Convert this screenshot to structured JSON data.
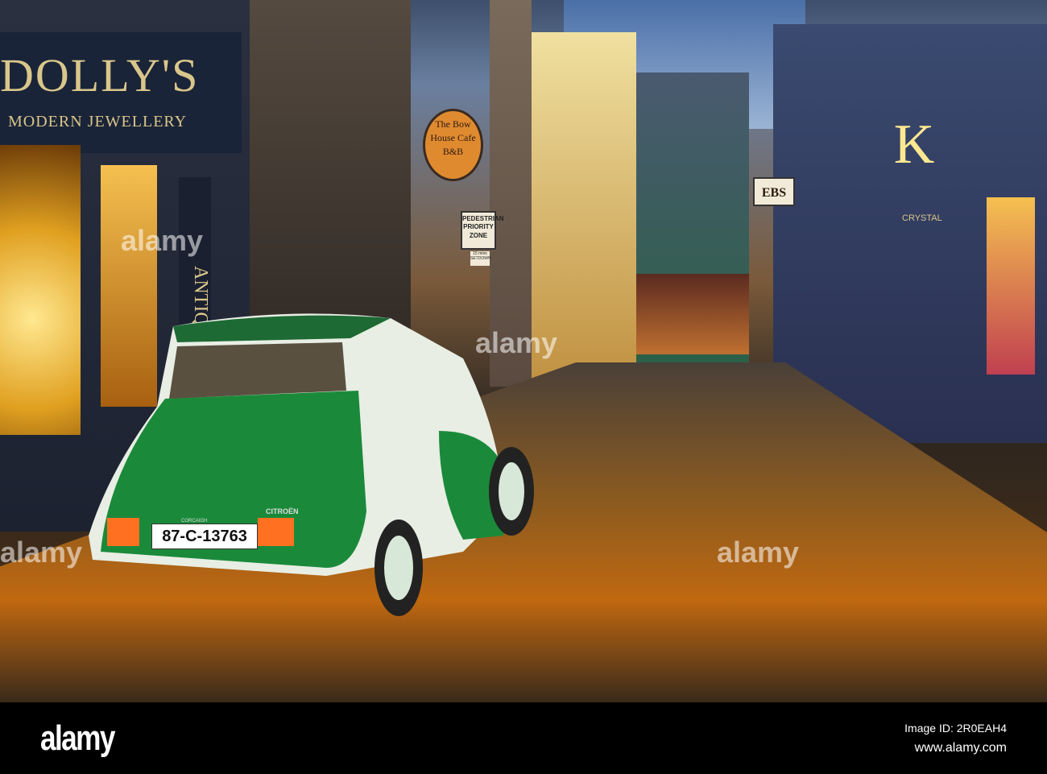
{
  "photo": {
    "shop_sign": "DOLLY'S",
    "shop_subtitle": "MODERN JEWELLERY",
    "antiques_sign": "ANTIQUES",
    "cafe_sign": "The Bow House Cafe B&B",
    "road_sign": "PEDESTRIAN PRIORITY ZONE",
    "setdown_sign": "15 mins SETDOWN",
    "bank_sign": "EBS",
    "hotel_letter": "K",
    "crystal_sign": "CRYSTAL",
    "license_plate": "87-C-13763",
    "plate_region": "CORCAIGH",
    "car_badge": "CITROËN",
    "watermarks": [
      "alamy",
      "alamy",
      "alamy",
      "alamy"
    ]
  },
  "footer": {
    "logo": "alamy",
    "image_id": "Image ID: 2R0EAH4",
    "url": "www.alamy.com"
  }
}
